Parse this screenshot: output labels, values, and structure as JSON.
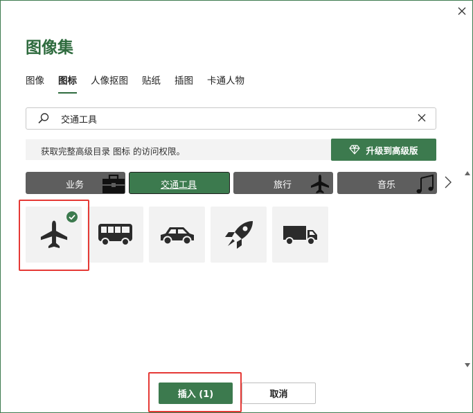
{
  "dialog": {
    "title": "图像集",
    "close_label": "✕"
  },
  "tabs": [
    {
      "label": "图像",
      "active": false
    },
    {
      "label": "图标",
      "active": true
    },
    {
      "label": "人像抠图",
      "active": false
    },
    {
      "label": "贴纸",
      "active": false
    },
    {
      "label": "插图",
      "active": false
    },
    {
      "label": "卡通人物",
      "active": false
    }
  ],
  "search": {
    "value": "交通工具",
    "icon": "search-icon",
    "clear_icon": "clear-icon"
  },
  "banner": {
    "message": "获取完整高级目录 图标 的访问权限。",
    "upgrade_label": "升级到高级版",
    "upgrade_icon": "diamond-icon"
  },
  "categories": [
    {
      "label": "业务",
      "icon": "briefcase-icon",
      "active": false
    },
    {
      "label": "交通工具",
      "icon": "",
      "active": true
    },
    {
      "label": "旅行",
      "icon": "airplane-icon",
      "active": false
    },
    {
      "label": "音乐",
      "icon": "music-note-icon",
      "active": false
    }
  ],
  "results": [
    {
      "icon": "airplane-icon",
      "selected": true
    },
    {
      "icon": "bus-icon",
      "selected": false
    },
    {
      "icon": "car-icon",
      "selected": false
    },
    {
      "icon": "rocket-icon",
      "selected": false
    },
    {
      "icon": "truck-icon",
      "selected": false
    }
  ],
  "footer": {
    "insert_label": "插入 (1)",
    "cancel_label": "取消"
  },
  "colors": {
    "accent": "#3c7a4e",
    "title": "#2e6b3e",
    "category_bg": "#5e5e5e",
    "highlight": "#e53935"
  }
}
